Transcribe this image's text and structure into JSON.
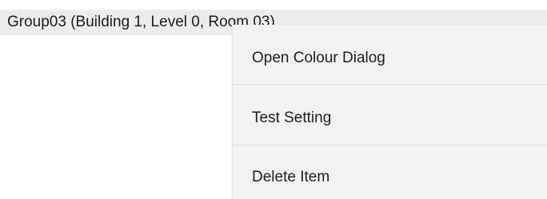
{
  "list": {
    "selected_row_label": "Group03 (Building 1, Level 0, Room 03)"
  },
  "context_menu": {
    "items": [
      {
        "label": "Open Colour Dialog"
      },
      {
        "label": "Test Setting"
      },
      {
        "label": "Delete Item"
      }
    ]
  }
}
